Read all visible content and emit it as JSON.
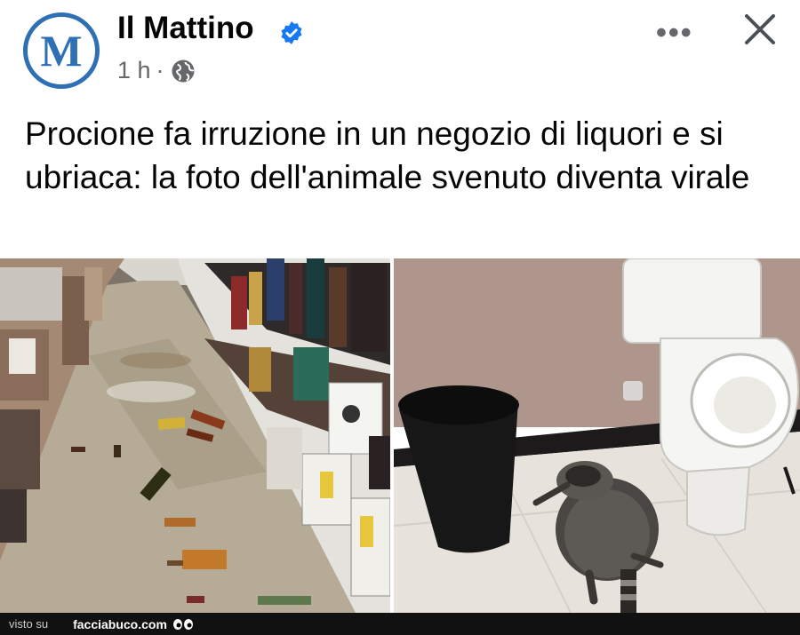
{
  "post": {
    "page_name": "Il Mattino",
    "avatar_letter": "M",
    "time": "1 h",
    "separator": "·",
    "text": "Procione fa irruzione in un negozio di liquori e si ubriaca: la foto dell'animale svenuto diventa virale",
    "more_label": "•••"
  },
  "footer": {
    "visto_su": "visto su",
    "site": "facciabuco.com"
  },
  "icons": {
    "verified": "verified-badge-icon",
    "globe": "globe-icon",
    "more": "more-options-icon",
    "close": "close-icon",
    "eyes": "eyes-icon"
  },
  "colors": {
    "brand_blue": "#2f6fb3",
    "verified_blue": "#1877f2",
    "secondary_text": "#65676b"
  }
}
